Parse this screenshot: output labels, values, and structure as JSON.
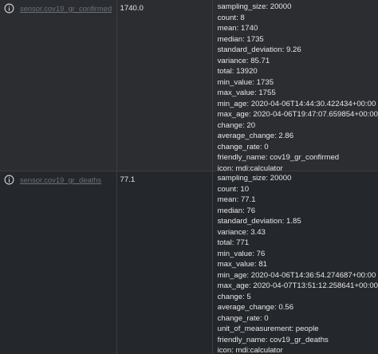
{
  "rows": [
    {
      "entity": "sensor.cov19_gr_confirmed",
      "state": "1740.0",
      "attributes": [
        "sampling_size: 20000",
        "count: 8",
        "mean: 1740",
        "median: 1735",
        "standard_deviation: 9.26",
        "variance: 85.71",
        "total: 13920",
        "min_value: 1735",
        "max_value: 1755",
        "min_age: 2020-04-06T14:44:30.422434+00:00",
        "max_age: 2020-04-06T19:47:07.659854+00:00",
        "change: 20",
        "average_change: 2.86",
        "change_rate: 0",
        "friendly_name: cov19_gr_confirmed",
        "icon: mdi:calculator"
      ]
    },
    {
      "entity": "sensor.cov19_gr_deaths",
      "state": "77.1",
      "attributes": [
        "sampling_size: 20000",
        "count: 10",
        "mean: 77.1",
        "median: 76",
        "standard_deviation: 1.85",
        "variance: 3.43",
        "total: 771",
        "min_value: 76",
        "max_value: 81",
        "min_age: 2020-04-06T14:36:54.274687+00:00",
        "max_age: 2020-04-07T13:51:12.258641+00:00",
        "change: 5",
        "average_change: 0.56",
        "change_rate: 0",
        "unit_of_measurement: people",
        "friendly_name: cov19_gr_deaths",
        "icon: mdi:calculator"
      ]
    }
  ],
  "icons": {
    "info": "info-circle-icon"
  }
}
